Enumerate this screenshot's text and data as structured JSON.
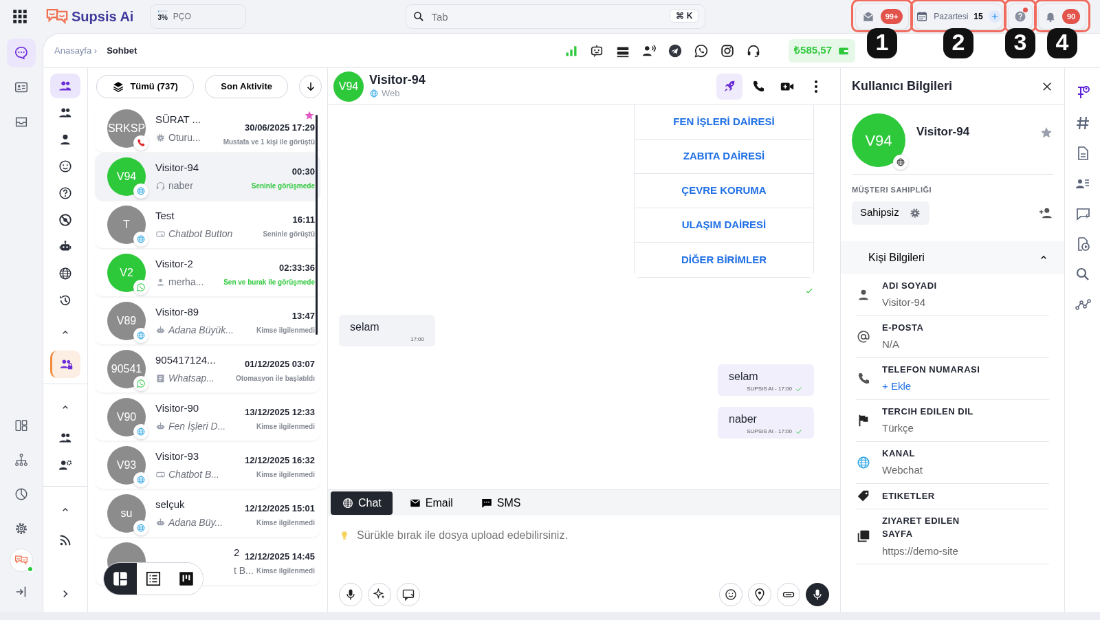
{
  "topbar": {
    "logo": "Supsis Ai",
    "quota": {
      "percent": "3%",
      "label": "PÇO",
      "level": 0.03
    },
    "search": {
      "placeholder": "Tab",
      "shortcut": "⌘ K"
    },
    "inbox_badge": "99+",
    "calendar": {
      "day": "Pazartesi",
      "date": "15"
    },
    "help_alert": true,
    "notifications": "90"
  },
  "callouts": [
    "1",
    "2",
    "3",
    "4"
  ],
  "nav_rail": [
    {
      "selected": true
    },
    {
      "selected": false
    },
    {
      "selected": false
    }
  ],
  "breadcrumb": [
    "Anasayfa ›",
    "Sohbet"
  ],
  "balance": "₺585,57",
  "filter_rail": [
    {
      "selected": true
    },
    {
      "selected": false
    },
    {
      "selected": false
    },
    {
      "selected": false
    },
    {
      "selected": false
    },
    {
      "selected": false
    },
    {
      "selected": false
    },
    {
      "selected": false
    },
    {
      "selected": false
    }
  ],
  "team_filter": {
    "selected": true
  },
  "list_toolbar": {
    "all": "Tümü (737)",
    "sort": "Son Aktivite"
  },
  "conversations": [
    {
      "kind": "full",
      "initials": "SRKSP",
      "name": "SÜRAT ...",
      "preview": {
        "kind": "system",
        "text": "Oturu..."
      },
      "time": "30/06/2025 17:29",
      "status": "Mustafa ve 1 kişi ile görüştü",
      "active": false,
      "selected": false,
      "starred": true,
      "channel": {
        "kind": "call"
      }
    },
    {
      "kind": "full",
      "initials": "V94",
      "name": "Visitor-94",
      "preview": {
        "kind": "agent",
        "text": "naber"
      },
      "time": "00:30",
      "status": "Seninle görüşmede",
      "active": true,
      "selected": true,
      "starred": false,
      "channel": {
        "kind": "web"
      }
    },
    {
      "kind": "full",
      "initials": "T",
      "name": "Test",
      "preview": {
        "kind": "button",
        "text": "Chatbot Button"
      },
      "time": "16:11",
      "status": "Seninle görüştü",
      "active": false,
      "selected": false,
      "starred": false,
      "channel": {
        "kind": "web"
      }
    },
    {
      "kind": "full",
      "initials": "V2",
      "name": "Visitor-2",
      "preview": {
        "kind": "visitor",
        "text": "merha..."
      },
      "time": "02:33:36",
      "status": "Sen ve burak ile görüşmede",
      "active": true,
      "selected": false,
      "starred": false,
      "channel": {
        "kind": "whatsapp"
      }
    },
    {
      "kind": "full",
      "initials": "V89",
      "name": "Visitor-89",
      "preview": {
        "kind": "bot",
        "text": "Adana Büyük..."
      },
      "time": "13:47",
      "status": "Kimse ilgilenmedi",
      "active": false,
      "selected": false,
      "starred": false,
      "channel": {
        "kind": "web"
      }
    },
    {
      "kind": "full",
      "initials": "90541",
      "name": "905417124...",
      "preview": {
        "kind": "template",
        "text": "Whatsap..."
      },
      "time": "01/12/2025 03:07",
      "status": "Otomasyon ile başlatıldı",
      "active": false,
      "selected": false,
      "starred": false,
      "channel": {
        "kind": "whatsapp"
      }
    },
    {
      "kind": "full",
      "initials": "V90",
      "name": "Visitor-90",
      "preview": {
        "kind": "bot",
        "text": "Fen İşleri D..."
      },
      "time": "13/12/2025 12:33",
      "status": "Kimse ilgilenmedi",
      "active": false,
      "selected": false,
      "starred": false,
      "channel": {
        "kind": "web"
      }
    },
    {
      "kind": "full",
      "initials": "V93",
      "name": "Visitor-93",
      "preview": {
        "kind": "button",
        "text": "Chatbot B..."
      },
      "time": "12/12/2025 16:32",
      "status": "Kimse ilgilenmedi",
      "active": false,
      "selected": false,
      "starred": false,
      "channel": {
        "kind": "web"
      }
    },
    {
      "kind": "full",
      "initials": "su",
      "name": "selçuk",
      "preview": {
        "kind": "bot",
        "text": "Adana Büy..."
      },
      "time": "12/12/2025 15:01",
      "status": "Kimse ilgilenmedi",
      "active": false,
      "selected": false,
      "starred": false,
      "channel": {
        "kind": "web"
      }
    },
    {
      "kind": "covered",
      "name": "2",
      "preview": {
        "text": "t B..."
      },
      "time": "12/12/2025 14:45",
      "status": "Kimse ilgilenmedi",
      "active": false,
      "selected": false,
      "starred": false
    }
  ],
  "view_switcher": [
    {
      "selected": true
    },
    {
      "selected": false
    },
    {
      "selected": false
    }
  ],
  "chat": {
    "initials": "V94",
    "name": "Visitor-94",
    "channel": "Web",
    "messages": [
      {
        "kind": "options",
        "options": [
          "FEN İŞLERİ DAİRESİ",
          "ZABITA DAİRESİ",
          "ÇEVRE KORUMA",
          "ULAŞIM DAİRESİ",
          "DİĞER BİRİMLER"
        ],
        "read": true
      },
      {
        "kind": "incoming",
        "text": "selam",
        "meta": "17:00"
      },
      {
        "kind": "outgoing",
        "text": "selam",
        "meta": "SUPSIS AI - 17:00",
        "read": true
      },
      {
        "kind": "outgoing",
        "text": "naber",
        "meta": "SUPSIS AI - 17:00",
        "read": true
      }
    ],
    "tabs": [
      {
        "label": "Chat",
        "selected": true
      },
      {
        "label": "Email",
        "selected": false
      },
      {
        "label": "SMS",
        "selected": false
      }
    ],
    "placeholder": "Sürükle bırak ile dosya upload edebilirsiniz."
  },
  "info": {
    "title": "Kullanıcı Bilgileri",
    "initials": "V94",
    "name": "Visitor-94",
    "starred": false,
    "ownership_label": "MÜŞTERI SAHIPLIĞI",
    "owner": "Sahipsiz",
    "section": "Kişi Bilgileri",
    "expanded": true,
    "fields": [
      {
        "label": "ADI SOYADI",
        "value": "Visitor-94",
        "kind": "text"
      },
      {
        "label": "E-POSTA",
        "value": "N/A",
        "kind": "text"
      },
      {
        "label": "TELEFON NUMARASI",
        "value": "+ Ekle",
        "kind": "link"
      },
      {
        "label": "TERCIH EDILEN DIL",
        "value": "Türkçe",
        "kind": "text"
      },
      {
        "label": "KANAL",
        "value": "Webchat",
        "kind": "text"
      },
      {
        "label": "ETIKETLER",
        "kind": "none"
      },
      {
        "label": "ZIYARET EDILEN SAYFA",
        "value": "https://demo-site",
        "kind": "text"
      }
    ]
  },
  "info_rail": [
    {
      "selected": true
    },
    {
      "selected": false
    },
    {
      "selected": false
    },
    {
      "selected": false
    },
    {
      "selected": false
    },
    {
      "selected": false
    },
    {
      "selected": false
    },
    {
      "selected": false
    }
  ]
}
